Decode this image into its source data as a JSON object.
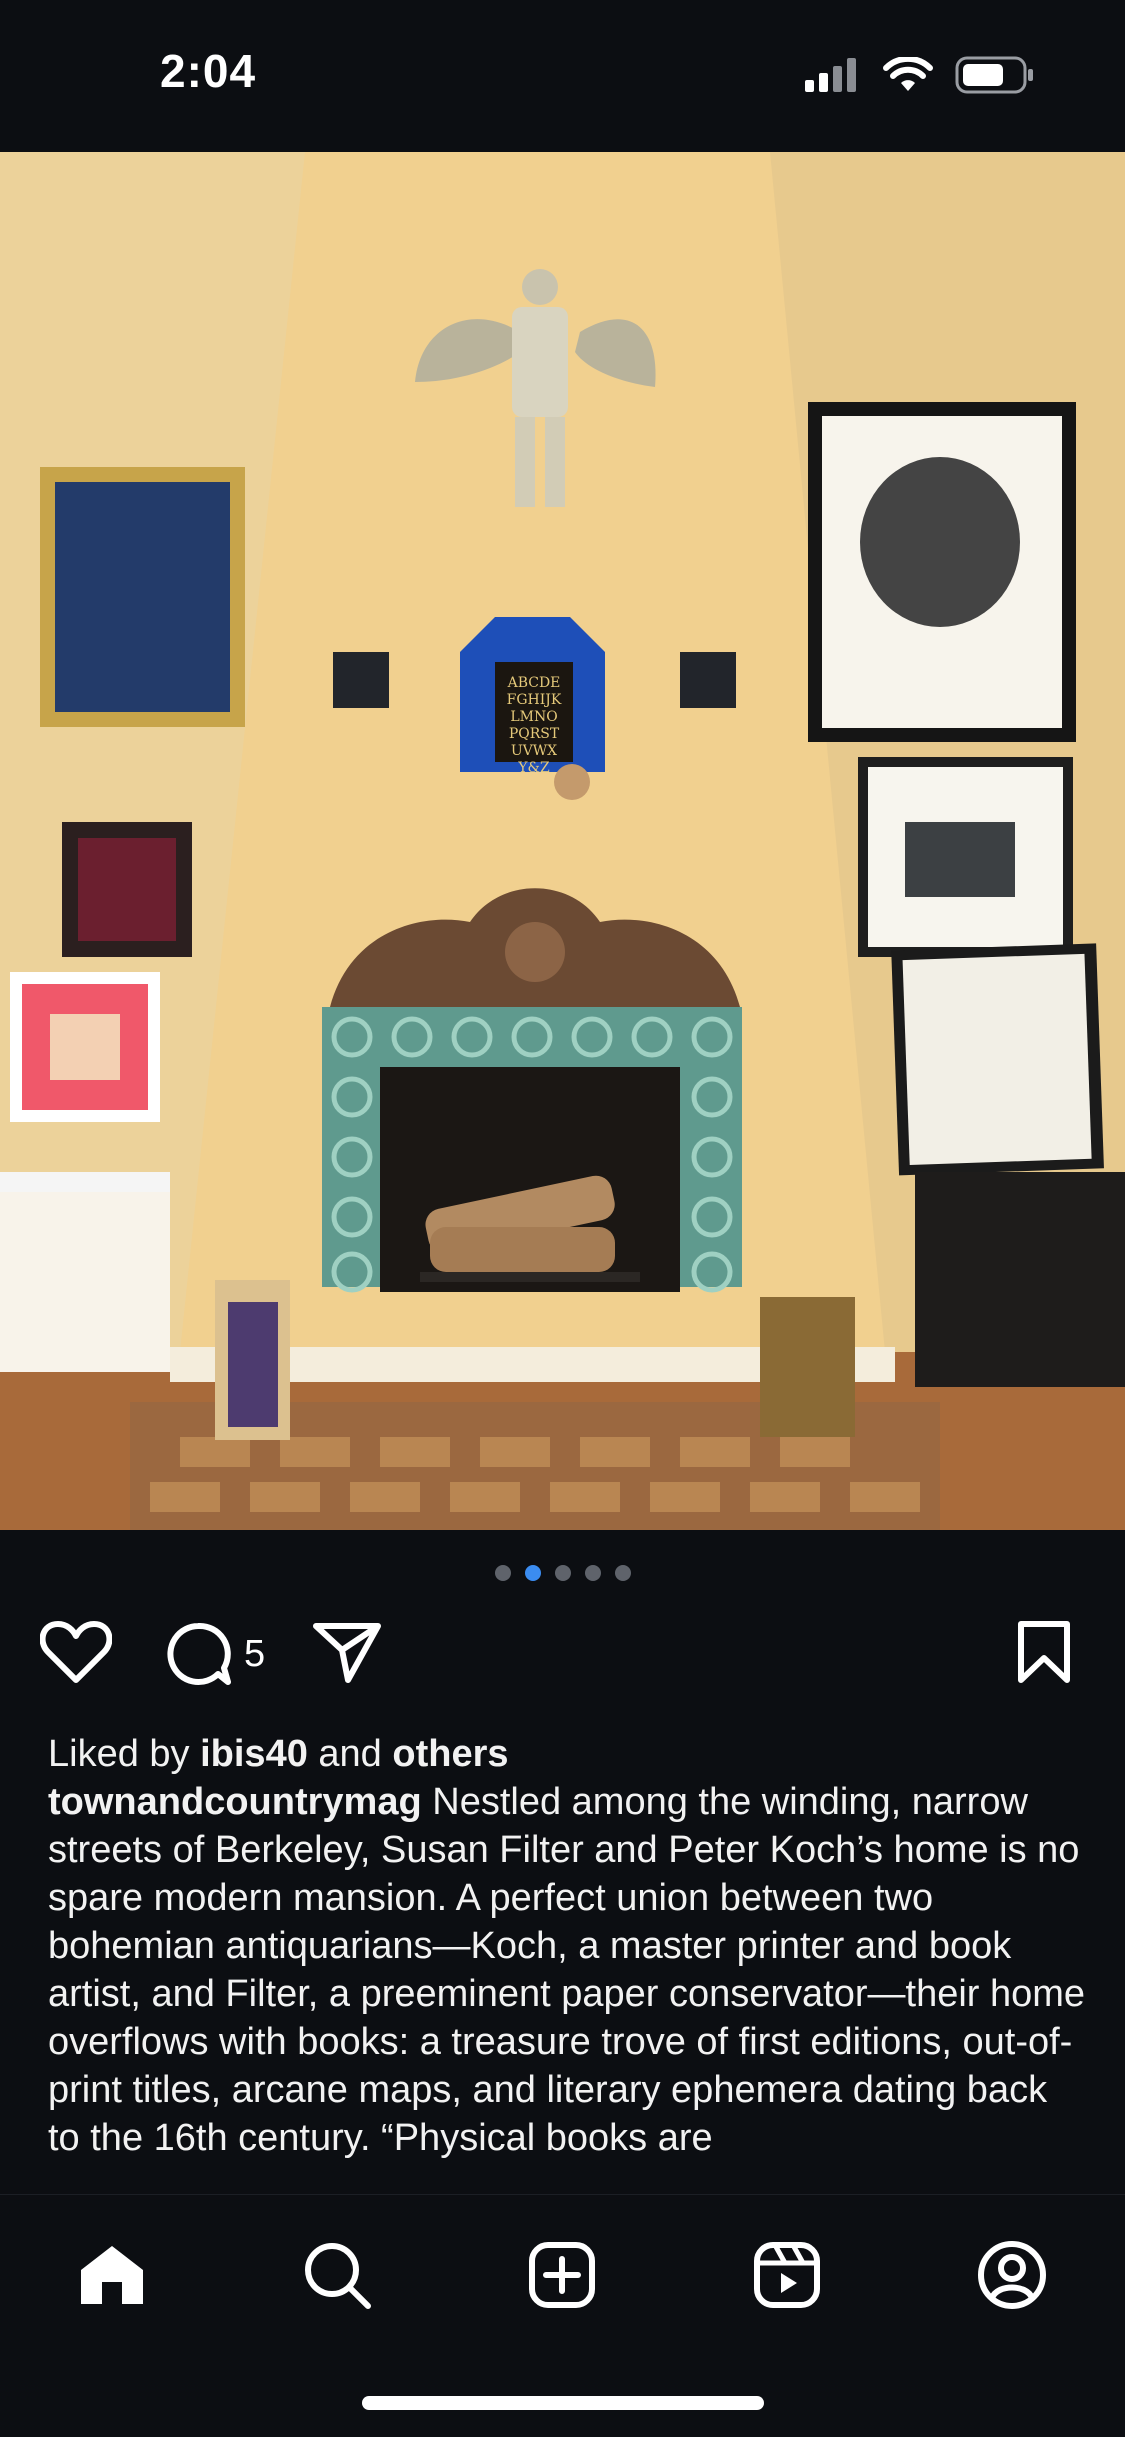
{
  "status_bar": {
    "time": "2:04"
  },
  "carousel": {
    "count": 5,
    "active_index": 1
  },
  "actions": {
    "comment_count": "5"
  },
  "likes": {
    "prefix": "Liked by",
    "user": "ibis40",
    "connector": "and",
    "others": "others"
  },
  "caption": {
    "author": "townandcountrymag",
    "text": "Nestled among the winding, narrow streets of Berkeley, Susan Filter and Peter Koch’s home is no spare modern mansion. A perfect union between two bohemian antiquarians—Koch, a master printer and book artist, and Filter, a preeminent paper conservator—their home overflows with books: a treasure trove of first editions, out-of-print titles, arcane maps, and literary ephemera dating back to the 16th century. “Physical books are"
  },
  "photo": {
    "niche_text": [
      "ABCDE",
      "FGHIJK",
      "LMNO",
      "PQRST",
      "UVWX",
      "Y&Z"
    ]
  },
  "icons": {
    "like": "heart-icon",
    "comment": "comment-bubble-icon",
    "share": "paper-plane-icon",
    "save": "bookmark-icon",
    "home": "home-icon",
    "search": "search-icon",
    "create": "plus-square-icon",
    "reels": "reels-icon",
    "profile": "profile-icon"
  },
  "colors": {
    "background": "#0c0e12",
    "active_dot": "#3b8cf0",
    "inactive_dot": "#5f636b"
  }
}
